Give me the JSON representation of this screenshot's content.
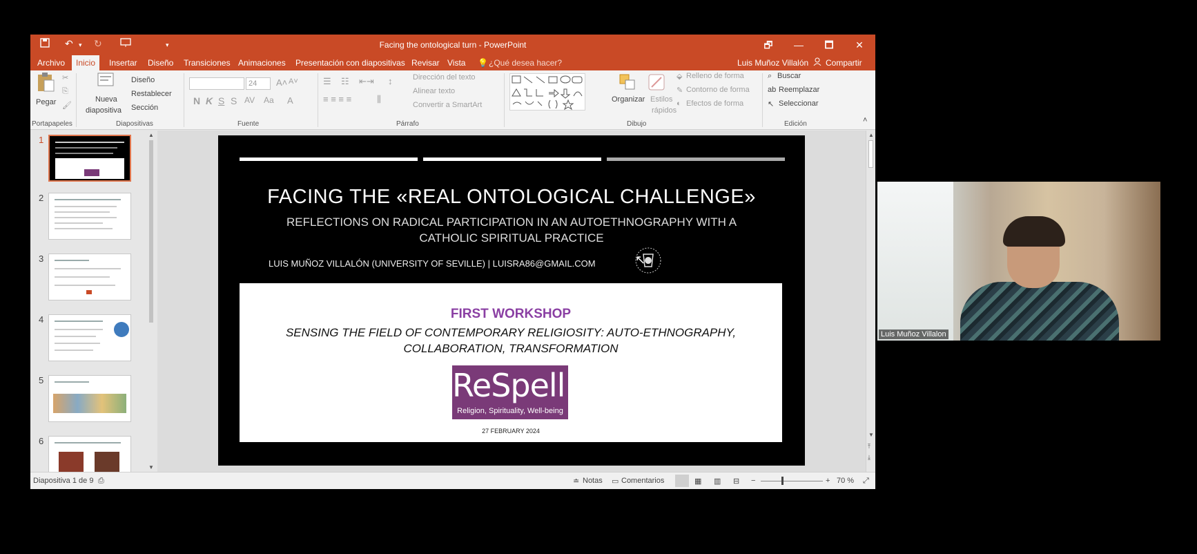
{
  "window": {
    "title": "Facing the ontological turn - PowerPoint",
    "controls": {
      "restore": "🗗",
      "minimize": "—",
      "maximize": "🗖",
      "close": "✕"
    }
  },
  "tabs": {
    "items": [
      "Archivo",
      "Inicio",
      "Insertar",
      "Diseño",
      "Transiciones",
      "Animaciones",
      "Presentación con diapositivas",
      "Revisar",
      "Vista"
    ],
    "tell_me": "¿Qué desea hacer?",
    "user": "Luis Muñoz Villalón",
    "share": "Compartir"
  },
  "ribbon": {
    "paste": "Pegar",
    "new_slide_1": "Nueva",
    "new_slide_2": "diapositiva",
    "layout": "Diseño",
    "reset": "Restablecer",
    "section": "Sección",
    "font_size": "24",
    "bold": "N",
    "italic": "K",
    "underline": "S",
    "strike": "S",
    "text_direction": "Dirección del texto",
    "align_text": "Alinear texto",
    "smartart": "Convertir a SmartArt",
    "arrange": "Organizar",
    "quick_styles_1": "Estilos",
    "quick_styles_2": "rápidos",
    "shape_fill": "Relleno de forma",
    "shape_outline": "Contorno de forma",
    "shape_effects": "Efectos de forma",
    "find": "Buscar",
    "replace": "Reemplazar",
    "select": "Seleccionar",
    "groups": {
      "clipboard": "Portapapeles",
      "slides": "Diapositivas",
      "font": "Fuente",
      "paragraph": "Párrafo",
      "drawing": "Dibujo",
      "editing": "Edición"
    }
  },
  "thumbnails": [
    "1",
    "2",
    "3",
    "4",
    "5",
    "6"
  ],
  "slide": {
    "title": "FACING THE «REAL ONTOLOGICAL CHALLENGE»",
    "subtitle": "REFLECTIONS ON RADICAL PARTICIPATION IN AN AUTOETHNOGRAPHY WITH A CATHOLIC SPIRITUAL PRACTICE",
    "author": "LUIS MUÑOZ VILLALÓN (UNIVERSITY OF SEVILLE) | LUISRA86@GMAIL.COM",
    "workshop": "FIRST WORKSHOP",
    "workshop_subtitle": "SENSING THE FIELD OF CONTEMPORARY RELIGIOSITY:  AUTO-ETHNOGRAPHY, COLLABORATION, TRANSFORMATION",
    "logo_main": "ReSpell.",
    "logo_tag": "Religion, Spirituality, Well-being",
    "date": "27 FEBRUARY 2024"
  },
  "statusbar": {
    "slide_count": "Diapositiva 1 de 9",
    "notes": "Notas",
    "comments": "Comentarios",
    "zoom": "70 %"
  },
  "webcam": {
    "name": "Luis Muñoz Villalon"
  },
  "colors": {
    "accent": "#c94a26",
    "workshop_purple": "#8a3fa3",
    "logo_bg": "#7a3a78"
  }
}
